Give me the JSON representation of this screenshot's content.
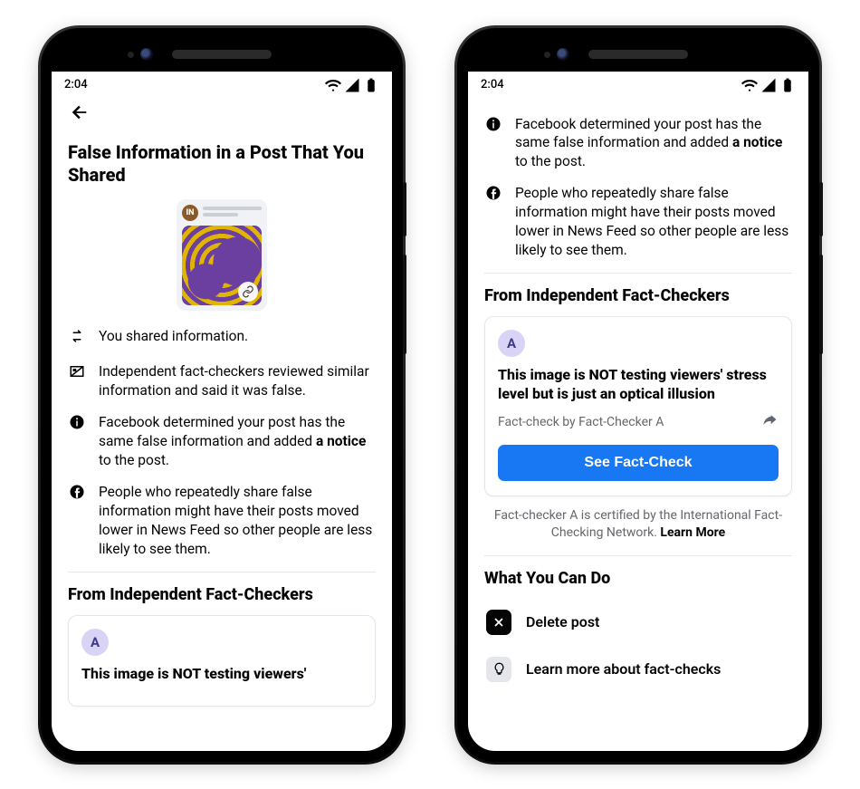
{
  "status": {
    "time": "2:04"
  },
  "page": {
    "title": "False Information in a Post That You Shared",
    "thumb_badge": "IN",
    "bullets": {
      "shared": "You shared information.",
      "reviewed": "Independent fact-checkers reviewed similar information and said it was false.",
      "determined_pre": "Facebook determined your post has the same false information and added ",
      "determined_bold": "a notice",
      "determined_post": " to the post.",
      "repeated": "People who repeatedly share false information might have their posts moved lower in News Feed so other people are less likely to see them."
    },
    "fc_section": "From Independent Fact-Checkers",
    "fc_card": {
      "avatar": "A",
      "headline": "This image is NOT testing viewers' stress level but is just an optical illusion",
      "headline_truncated": "This image is NOT testing viewers'",
      "byline": "Fact-check by Fact-Checker A",
      "button": "See Fact-Check"
    },
    "cert_pre": "Fact-checker A is certified by the International Fact-Checking Network. ",
    "cert_link": "Learn More",
    "actions_section": "What You Can Do",
    "actions": {
      "delete": "Delete post",
      "learn": "Learn more about fact-checks"
    }
  }
}
